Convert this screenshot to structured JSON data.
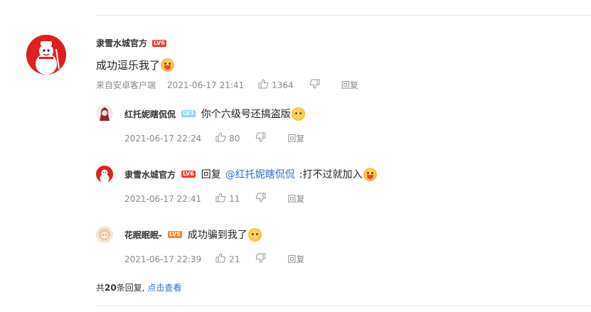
{
  "main_comment": {
    "nickname": "隶雪水城官方",
    "level": "LV6",
    "content": "成功逗乐我了",
    "source": "来自安卓客户端",
    "time": "2021-06-17 21:41",
    "likes": "1364",
    "reply_label": "回复"
  },
  "replies": [
    {
      "nickname": "红托妮瞎侃侃",
      "level": "LV3",
      "content": "你个六级号还搞盗版",
      "time": "2021-06-17 22:24",
      "likes": "80",
      "reply_label": "回复"
    },
    {
      "nickname": "隶雪水城官方",
      "level": "LV6",
      "reply_prefix": "回复",
      "mention": "@红托妮瞎侃侃",
      "content": ":打不过就加入",
      "time": "2021-06-17 22:41",
      "likes": "11",
      "reply_label": "回复"
    },
    {
      "nickname": "花眠眠眠-",
      "level": "LV5",
      "content": "成功骗到我了",
      "time": "2021-06-17 22:39",
      "likes": "21",
      "reply_label": "回复"
    }
  ],
  "summary": {
    "prefix": "共",
    "count": "20",
    "suffix": "条回复,",
    "link": "点击查看"
  },
  "colors": {
    "link": "#2f6ecb",
    "lv6": "#f03b2e",
    "lv3": "#8fd3f2",
    "lv5": "#f5872c"
  }
}
